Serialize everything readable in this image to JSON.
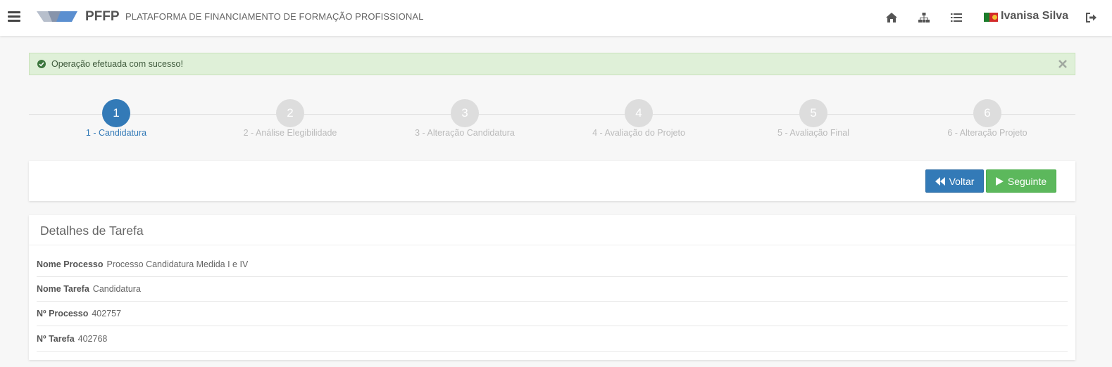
{
  "header": {
    "brand": "PFFP",
    "subtitle": "PLATAFORMA DE FINANCIAMENTO DE FORMAÇÃO PROFISSIONAL",
    "icons": [
      "home-icon",
      "sitemap-icon",
      "list-icon"
    ],
    "user": {
      "name": "Ivanisa Silva",
      "flag": "portugal-flag-icon"
    },
    "logout_icon": "sign-out-icon"
  },
  "alert": {
    "message": "Operação efetuada com sucesso!",
    "type": "success",
    "icon": "check-circle-icon",
    "close_icon": "close-icon"
  },
  "steps": [
    {
      "number": "1",
      "label": "1 - Candidatura",
      "active": true
    },
    {
      "number": "2",
      "label": "2 - Análise Elegibilidade",
      "active": false
    },
    {
      "number": "3",
      "label": "3 - Alteração Candidatura",
      "active": false
    },
    {
      "number": "4",
      "label": "4 - Avaliação do Projeto",
      "active": false
    },
    {
      "number": "5",
      "label": "5 - Avaliação Final",
      "active": false
    },
    {
      "number": "6",
      "label": "6 - Alteração Projeto",
      "active": false
    }
  ],
  "actions": {
    "back_label": "Voltar",
    "next_label": "Seguinte"
  },
  "details": {
    "title": "Detalhes de Tarefa",
    "rows": [
      {
        "label": "Nome Processo",
        "value": "Processo Candidatura Medida I e IV"
      },
      {
        "label": "Nome Tarefa",
        "value": "Candidatura"
      },
      {
        "label": "Nº Processo",
        "value": "402757"
      },
      {
        "label": "Nº Tarefa",
        "value": "402768"
      }
    ]
  },
  "colors": {
    "primary": "#337ab7",
    "success": "#5cb85c",
    "alert_bg": "#dff0d8",
    "step_inactive": "#dddddd"
  }
}
